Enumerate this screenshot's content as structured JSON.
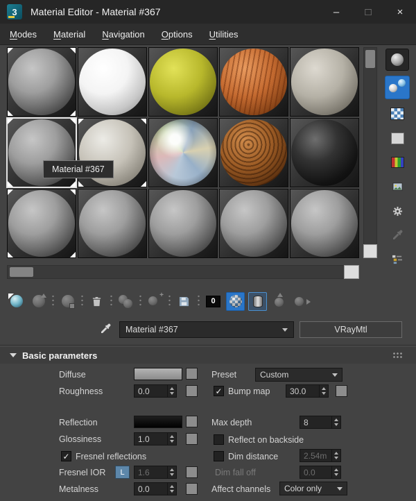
{
  "window": {
    "title": "Material Editor - Material #367",
    "app_icon_text": "3",
    "controls": {
      "minimize": "–",
      "maximize": "□",
      "close": "×"
    }
  },
  "menu": {
    "items": [
      "Modes",
      "Material",
      "Navigation",
      "Options",
      "Utilities"
    ]
  },
  "samples": {
    "tooltip": "Material #367",
    "slots": [
      {
        "type": "gray",
        "corners": true
      },
      {
        "type": "white"
      },
      {
        "type": "yellow"
      },
      {
        "type": "wood-orange"
      },
      {
        "type": "concrete"
      },
      {
        "type": "gray",
        "corners": true,
        "selected": true
      },
      {
        "type": "stone",
        "corners": true
      },
      {
        "type": "chrome"
      },
      {
        "type": "wood-dark"
      },
      {
        "type": "black"
      },
      {
        "type": "gray",
        "corners": true
      },
      {
        "type": "gray"
      },
      {
        "type": "gray"
      },
      {
        "type": "gray"
      },
      {
        "type": "gray"
      }
    ]
  },
  "side_toolbar": {
    "buttons": [
      {
        "name": "sample-type",
        "icon": "sphere",
        "pressed": true
      },
      {
        "name": "backlight",
        "icon": "backlight",
        "active": true
      },
      {
        "name": "background",
        "icon": "checker"
      },
      {
        "name": "sample-uv-tiling",
        "icon": "tile"
      },
      {
        "name": "video-color-check",
        "icon": "color-bars"
      },
      {
        "name": "generate-preview",
        "icon": "preview"
      },
      {
        "name": "options",
        "icon": "gear"
      },
      {
        "name": "select-by-material",
        "icon": "picker",
        "disabled": true
      },
      {
        "name": "material-map-navigator",
        "icon": "navigator"
      }
    ]
  },
  "toolbar": {
    "buttons": [
      {
        "name": "get-material",
        "icon": "sphere-pick"
      },
      {
        "name": "put-material-to-scene",
        "icon": "sphere-up",
        "disabled": true
      },
      {
        "sep": true
      },
      {
        "name": "assign-material-to-selection",
        "icon": "sphere-assign",
        "disabled": true
      },
      {
        "sep": true
      },
      {
        "name": "reset-material",
        "icon": "trash"
      },
      {
        "sep": true
      },
      {
        "name": "make-material-copy",
        "icon": "sphere-copy",
        "disabled": true
      },
      {
        "sep": true
      },
      {
        "name": "make-unique",
        "icon": "sphere-unique",
        "disabled": true
      },
      {
        "sep": true
      },
      {
        "name": "put-to-library",
        "icon": "disk"
      },
      {
        "sep": true
      },
      {
        "name": "material-id-channel",
        "icon": "zero",
        "label": "0"
      },
      {
        "name": "show-shaded-material-in-viewport",
        "icon": "checker-sphere",
        "active": true
      },
      {
        "name": "show-end-result",
        "icon": "cylinder",
        "toggled": true
      },
      {
        "name": "go-to-parent",
        "icon": "sphere-parent",
        "disabled": true
      },
      {
        "name": "go-forward-to-sibling",
        "icon": "sphere-sibling",
        "disabled": true
      }
    ]
  },
  "material_bar": {
    "material_name": "Material #367",
    "type_button": "VRayMtl"
  },
  "rollout": {
    "title": "Basic parameters"
  },
  "basic": {
    "diffuse": {
      "label": "Diffuse",
      "color": "#a9a9a9"
    },
    "roughness": {
      "label": "Roughness",
      "value": "0.0"
    },
    "preset": {
      "label": "Preset",
      "value": "Custom"
    },
    "bump": {
      "label": "Bump map",
      "checked": true,
      "value": "30.0"
    },
    "reflection": {
      "label": "Reflection",
      "color": "#000000"
    },
    "glossiness": {
      "label": "Glossiness",
      "value": "1.0"
    },
    "max_depth": {
      "label": "Max depth",
      "value": "8"
    },
    "reflect_backside": {
      "label": "Reflect on backside",
      "checked": false
    },
    "fresnel": {
      "label": "Fresnel reflections",
      "checked": true
    },
    "dim_distance": {
      "label": "Dim distance",
      "checked": false,
      "value": "2.54m"
    },
    "fresnel_ior": {
      "label": "Fresnel IOR",
      "lock": "L",
      "value": "1.6"
    },
    "dim_falloff": {
      "label": "Dim fall off",
      "value": "0.0"
    },
    "metalness": {
      "label": "Metalness",
      "value": "0.0"
    },
    "affect_channels": {
      "label": "Affect channels",
      "value": "Color only"
    }
  },
  "colors": {
    "accent_blue": "#2a76c9",
    "lock_button": "#5d87aa"
  }
}
